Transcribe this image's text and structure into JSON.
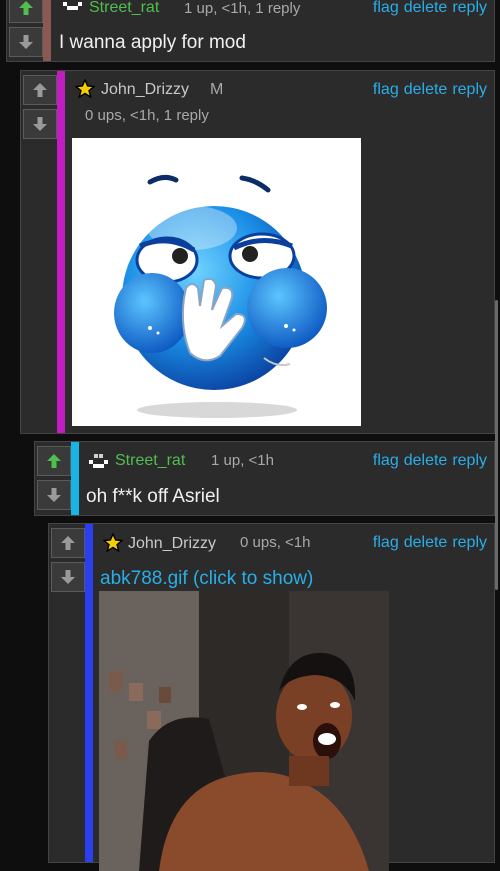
{
  "comments": [
    {
      "user": "Street_rat",
      "meta": "1 up, <1h, 1 reply",
      "body": "I wanna apply for mod"
    },
    {
      "user": "John_Drizzy",
      "flair": "M",
      "meta": "0 ups, <1h, 1 reply"
    },
    {
      "user": "Street_rat",
      "meta": "1 up, <1h",
      "body": "oh f**k off Asriel"
    },
    {
      "user": "John_Drizzy",
      "meta": "0 ups, <1h",
      "link": "abk788.gif (click to show)"
    }
  ],
  "actions": {
    "flag": "flag",
    "delete": "delete",
    "reply": "reply"
  },
  "colors": {
    "accent_link": "#29aee8",
    "upvoted": "#4fbf4f",
    "bar_1": "#8a5a52",
    "bar_2": "#c01ec0",
    "bar_3": "#19b4e6",
    "bar_4": "#2b3ff0"
  }
}
